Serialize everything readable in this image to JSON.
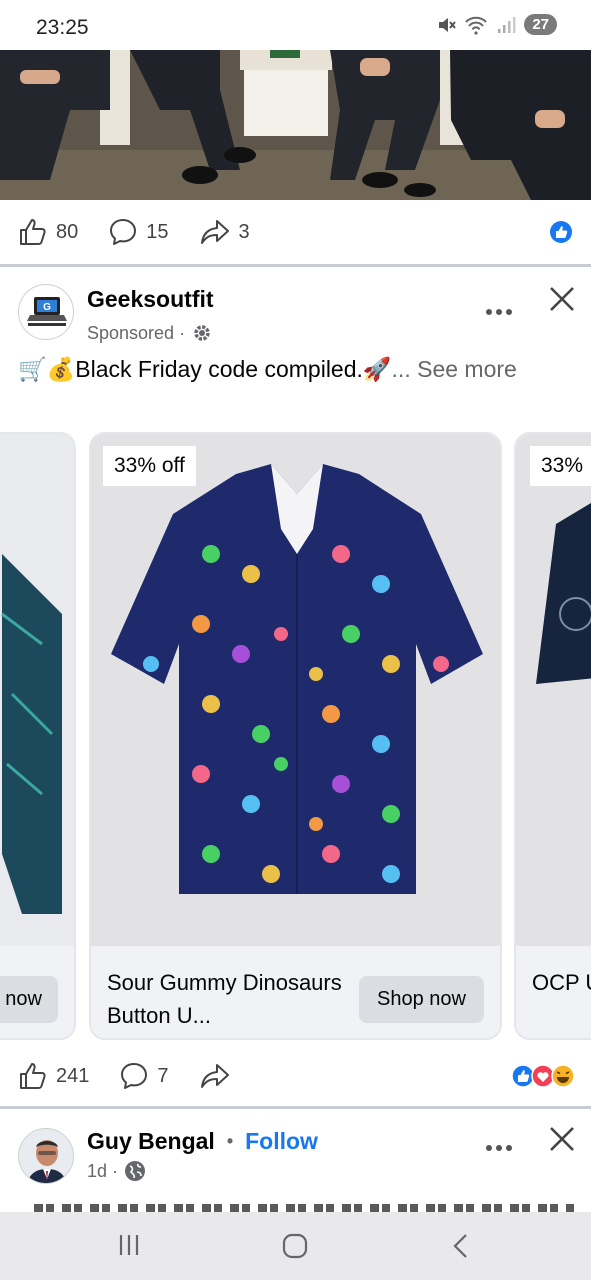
{
  "status": {
    "time": "23:25",
    "battery": "27"
  },
  "post1": {
    "likes": "80",
    "comments": "15",
    "shares": "3"
  },
  "ad": {
    "author": "Geeksoutfit",
    "meta": "Sponsored ·",
    "caption": "🛒💰Black Friday code compiled.🚀",
    "see_more": "... See more",
    "likes": "241",
    "comments": "7"
  },
  "carousel": {
    "left_card": {
      "shop_label": "now"
    },
    "center_card": {
      "discount": "33% off",
      "title": "Sour Gummy Dinosaurs Button U...",
      "shop_label": "Shop now"
    },
    "right_card": {
      "discount": "33%",
      "title": "OCP U Up Po"
    }
  },
  "post3": {
    "author": "Guy Bengal",
    "separator": "•",
    "follow": "Follow",
    "meta": "1d ·"
  },
  "icons": {
    "like": "thumbs-up-icon",
    "comment": "comment-bubble-icon",
    "share": "share-arrow-icon",
    "settings": "gear-icon",
    "public": "globe-icon",
    "more": "more-dots-icon",
    "close": "close-icon"
  },
  "colors": {
    "facebook_blue": "#1877f2",
    "love_red": "#f33e58",
    "haha_yellow": "#f7b125",
    "muted_text": "#65676b"
  }
}
